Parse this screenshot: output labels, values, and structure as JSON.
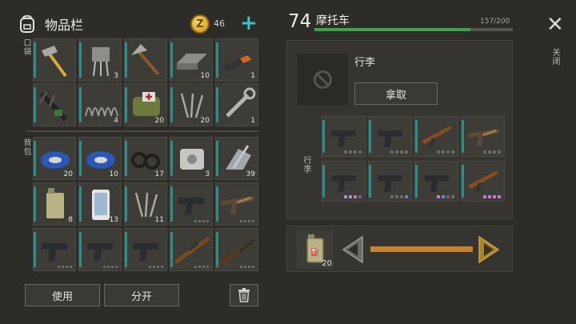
{
  "inventory": {
    "title": "物品栏",
    "coin_symbol": "Z",
    "coins": "46",
    "add_symbol": "+",
    "pocket_label": "口袋",
    "backpack_label": "背包",
    "pocket_items": [
      {
        "name": "hammer-icon",
        "count": ""
      },
      {
        "name": "transistor-icon",
        "count": "3"
      },
      {
        "name": "axe-icon",
        "count": ""
      },
      {
        "name": "steel-bar-icon",
        "count": "10"
      },
      {
        "name": "usb-drive-icon",
        "count": "1"
      },
      {
        "name": "crossbow-icon",
        "count": ""
      },
      {
        "name": "spring-icon",
        "count": "4"
      },
      {
        "name": "first-aid-bag-icon",
        "count": "20"
      },
      {
        "name": "nails-icon",
        "count": "20"
      },
      {
        "name": "wrench-icon",
        "count": "1"
      }
    ],
    "backpack_items": [
      {
        "name": "duct-tape-icon",
        "count": "20"
      },
      {
        "name": "duct-tape-icon",
        "count": "10"
      },
      {
        "name": "rubber-rings-icon",
        "count": "17"
      },
      {
        "name": "engine-part-icon",
        "count": "3"
      },
      {
        "name": "scrap-metal-icon",
        "count": "39"
      },
      {
        "name": "jerrycan-icon",
        "count": "8"
      },
      {
        "name": "smartphone-icon",
        "count": "13"
      },
      {
        "name": "nails-icon",
        "count": "11"
      },
      {
        "name": "pistol-icon",
        "count": ""
      },
      {
        "name": "assault-rifle-icon",
        "count": ""
      },
      {
        "name": "pistol-icon",
        "count": ""
      },
      {
        "name": "pistol-icon",
        "count": ""
      },
      {
        "name": "pistol-icon",
        "count": ""
      },
      {
        "name": "sniper-rifle-icon",
        "count": ""
      },
      {
        "name": "shotgun-icon",
        "count": ""
      }
    ],
    "use_label": "使用",
    "split_label": "分开",
    "trash_icon": "trash-icon"
  },
  "vehicle": {
    "level": "74",
    "name": "摩托车",
    "capacity_text": "157/200",
    "capacity_fraction": 0.785,
    "luggage_label": "行李",
    "take_label": "拿取",
    "luggage_side_label": "行李",
    "items": [
      {
        "name": "pistol-icon",
        "dots": [
          "#6c6b66",
          "#6c6b66",
          "#6c6b66",
          "#6c6b66"
        ]
      },
      {
        "name": "pistol-icon",
        "dots": [
          "#6c6b66",
          "#6c6b66",
          "#6c6b66",
          "#6c6b66"
        ]
      },
      {
        "name": "ak-rifle-icon",
        "dots": [
          "#6c6b66",
          "#6c6b66",
          "#6c6b66",
          "#6c6b66"
        ]
      },
      {
        "name": "assault-rifle-icon",
        "dots": [
          "#6c6b66",
          "#6c6b66",
          "#6c6b66",
          "#6c6b66"
        ]
      },
      {
        "name": "pistol-icon",
        "dots": [
          "#9a9ad8",
          "#9a9ad8",
          "#c07ad8",
          "#6c6b66"
        ]
      },
      {
        "name": "pistol-icon",
        "dots": [
          "#6c6b66",
          "#6c6b66",
          "#6c6b66",
          "#5a8fd8"
        ]
      },
      {
        "name": "pistol-icon",
        "dots": [
          "#c07ad8",
          "#5a8fd8",
          "#6c6b66",
          "#6c6b66"
        ]
      },
      {
        "name": "ak-rifle-icon",
        "dots": [
          "#c07ad8",
          "#c07ad8",
          "#c07ad8",
          "#c07ad8"
        ]
      }
    ],
    "fuel_count": "20",
    "fuel_icon": "jerrycan-icon",
    "left_arrow": "decrease-arrow-icon",
    "right_arrow": "increase-arrow-icon"
  },
  "close_label": "关闭"
}
